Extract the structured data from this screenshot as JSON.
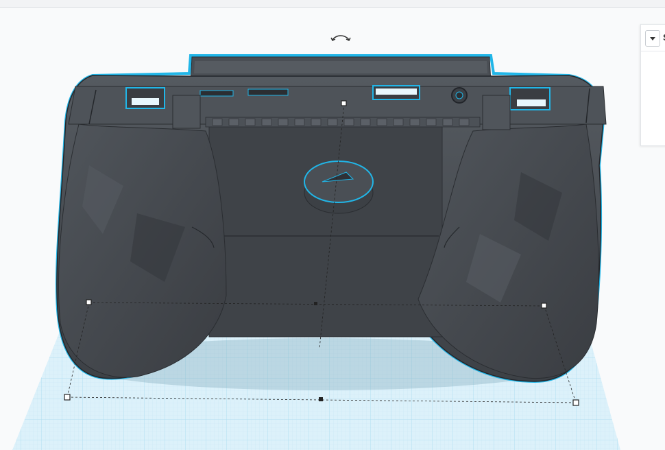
{
  "app": {
    "view": "3D workplane",
    "panel": {
      "title": "S",
      "dropdown_icon": "chevron-down-icon"
    }
  },
  "viewport": {
    "rotate_icon": "rotate-arrows-icon",
    "selected_object": "game-controller-shell",
    "handles": "resize-handles"
  },
  "colors": {
    "workplane_grid": "#bfe3f2",
    "workplane_fill": "#d6eef8",
    "model_body": "#4b4f55",
    "model_dark": "#33363b",
    "selection_outline": "#21b6e8",
    "handle_fill": "#ffffff",
    "handle_stroke": "#222222"
  }
}
